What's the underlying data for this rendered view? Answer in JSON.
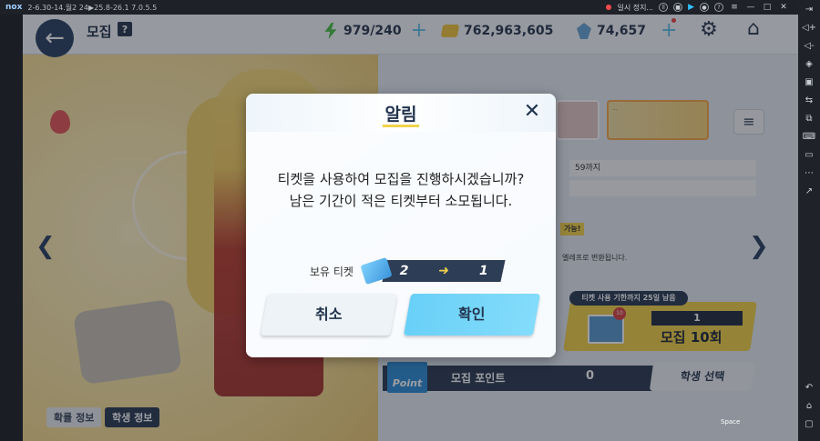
{
  "emulator": {
    "logo": "nox",
    "version_text": "2-6.30-14.월2 24▶25.8-26.1 7.0.5.5",
    "status_text": "일시 정지..."
  },
  "header": {
    "title": "모집",
    "help": "?",
    "resources": {
      "ap": "979/240",
      "credits": "762,963,605",
      "pyroxene": "74,657"
    }
  },
  "left_tabs": {
    "probability": "확률 정보",
    "student_info": "학생 정보"
  },
  "right_panel": {
    "banner_small_text": "...",
    "info_line1": "59까지",
    "info_yellow": "가능!",
    "info_text": "엘레프로 변환됩니다."
  },
  "recruit10": {
    "tag": "티켓 사용 기한까지 25일 남음",
    "badge": "10",
    "count": "1",
    "label": "모집 10회"
  },
  "points": {
    "icon_text": "Point",
    "label": "모집 포인트",
    "value": "0",
    "student_select": "학생 선택"
  },
  "dialog": {
    "title": "알림",
    "message_line1": "티켓을 사용하여 모집을 진행하시겠습니까?",
    "message_line2": "남은 기간이 적은 티켓부터 소모됩니다.",
    "ticket_label": "보유 티켓",
    "ticket_from": "2",
    "ticket_to": "1",
    "cancel": "취소",
    "confirm": "확인"
  },
  "hint": "Space"
}
